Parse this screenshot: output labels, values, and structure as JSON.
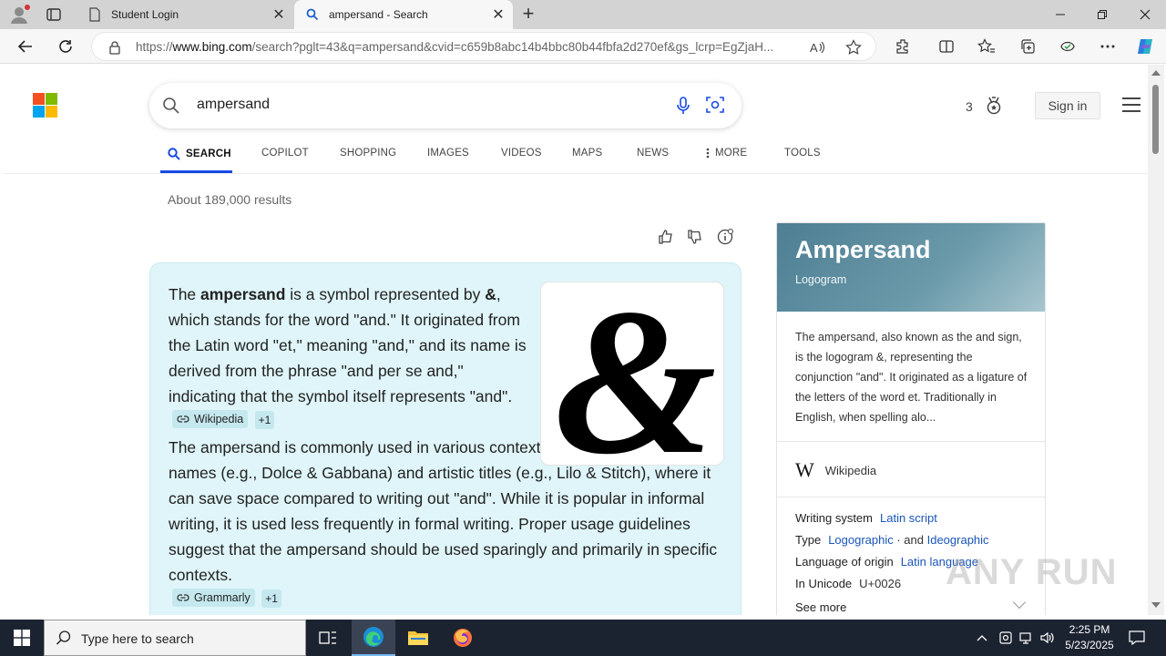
{
  "browser": {
    "tabs": [
      {
        "title": "Student Login"
      },
      {
        "title": "ampersand - Search"
      }
    ],
    "url_prefix": "https://",
    "url_host": "www.bing.com",
    "url_rest": "/search?pglt=43&q=ampersand&cvid=c659b8abc14b4bbc80b44fbfa2d270ef&gs_lcrp=EgZjaH..."
  },
  "search": {
    "query": "ampersand",
    "rewards_count": "3",
    "signin_label": "Sign in"
  },
  "scopes": [
    {
      "label": "SEARCH"
    },
    {
      "label": "COPILOT"
    },
    {
      "label": "SHOPPING"
    },
    {
      "label": "IMAGES"
    },
    {
      "label": "VIDEOS"
    },
    {
      "label": "MAPS"
    },
    {
      "label": "NEWS"
    },
    {
      "label": "MORE"
    },
    {
      "label": "TOOLS"
    }
  ],
  "results_count": "About 189,000 results",
  "answer": {
    "p1_a": "The ",
    "p1_bold": "ampersand",
    "p1_b": " is a symbol represented by ",
    "p1_bold2": "&",
    "p1_c": ", which stands for the word \"and.\" It originated from the Latin word \"et,\" meaning \"and,\" and its name is derived from the phrase \"and per se and,\" indicating that the symbol itself represents \"and\".",
    "p1_source": "Wikipedia",
    "p1_plus": "+1",
    "p2": "The ampersand is commonly used in various contexts, such as in company names (e.g., Dolce & Gabbana) and artistic titles (e.g., Lilo & Stitch), where it can save space compared to writing out \"and\". While it is popular in informal writing, it is used less frequently in formal writing. Proper usage guidelines suggest that the ampersand should be used sparingly and primarily in specific contexts.",
    "p2_source": "Grammarly",
    "p2_plus": "+1"
  },
  "knowledge_panel": {
    "title": "Ampersand",
    "subtitle": "Logogram",
    "description": "The ampersand, also known as the and sign, is the logogram &, representing the conjunction \"and\". It originated as a ligature of the letters of the word et. Traditionally in English, when spelling alo...",
    "source": "Wikipedia",
    "facts": [
      {
        "label": "Writing system",
        "value": "Latin script"
      },
      {
        "label": "Type",
        "value": "Logographic",
        "sep": " · and ",
        "value2": "Ideographic"
      },
      {
        "label": "Language of origin",
        "value": "Latin language"
      },
      {
        "label": "In Unicode",
        "plain": "U+0026"
      }
    ],
    "see_more": "See more"
  },
  "watermark": "ANY RUN",
  "taskbar": {
    "search_placeholder": "Type here to search",
    "time": "2:25 PM",
    "date": "5/23/2025"
  },
  "colors": {
    "accent": "#174ae4",
    "answer_bg": "#dff5f9",
    "link": "#1a55b8"
  }
}
